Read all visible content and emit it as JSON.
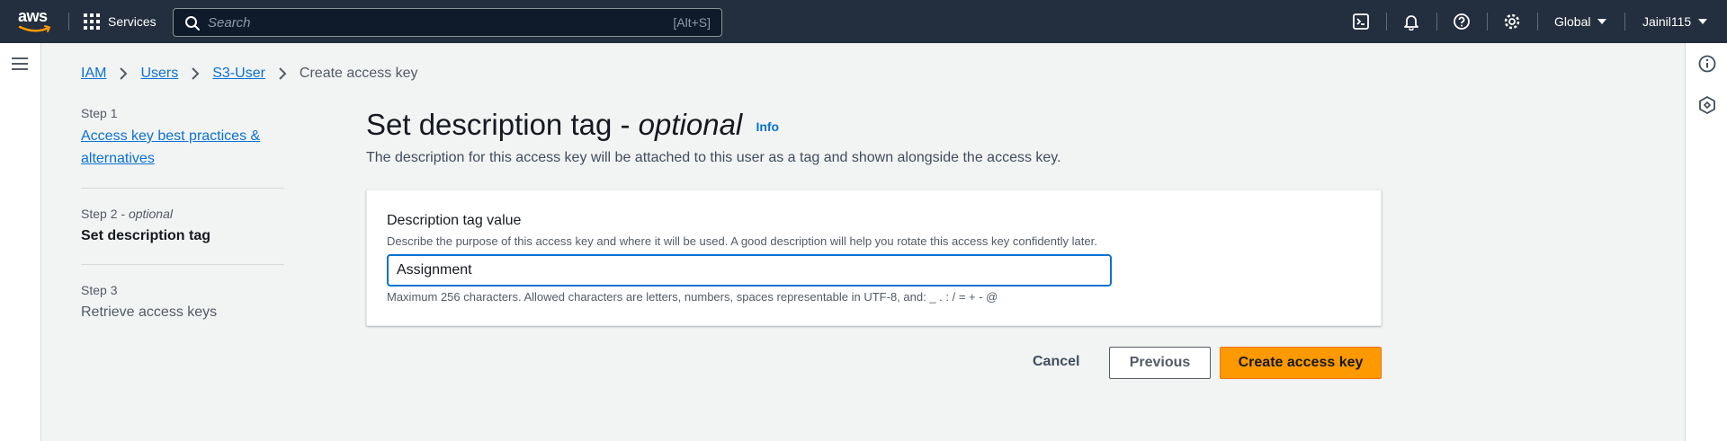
{
  "topnav": {
    "logo_text": "aws",
    "services_label": "Services",
    "search_placeholder": "Search",
    "search_shortcut": "[Alt+S]",
    "region_label": "Global",
    "account_label": "Jainil115",
    "icons": [
      "cloudshell-icon",
      "notifications-icon",
      "help-icon",
      "settings-icon"
    ]
  },
  "breadcrumb": {
    "items": [
      "IAM",
      "Users",
      "S3-User"
    ],
    "current": "Create access key"
  },
  "steps": [
    {
      "number": "Step 1",
      "title": "Access key best practices & alternatives",
      "state": "link"
    },
    {
      "number": "Step 2",
      "optional": "optional",
      "title": "Set description tag",
      "state": "current"
    },
    {
      "number": "Step 3",
      "title": "Retrieve access keys",
      "state": "disabled"
    }
  ],
  "page": {
    "title_main": "Set description tag - ",
    "title_optional": "optional",
    "info_label": "Info",
    "description": "The description for this access key will be attached to this user as a tag and shown alongside the access key."
  },
  "form": {
    "label": "Description tag value",
    "description": "Describe the purpose of this access key and where it will be used. A good description will help you rotate this access key confidently later.",
    "value": "Assignment",
    "constraint": "Maximum 256 characters. Allowed characters are letters, numbers, spaces representable in UTF-8, and: _ . : / = + - @"
  },
  "actions": {
    "cancel": "Cancel",
    "previous": "Previous",
    "create": "Create access key"
  },
  "colors": {
    "nav_bg": "#232f3e",
    "link": "#0972d3",
    "primary_button": "#ff9900"
  }
}
